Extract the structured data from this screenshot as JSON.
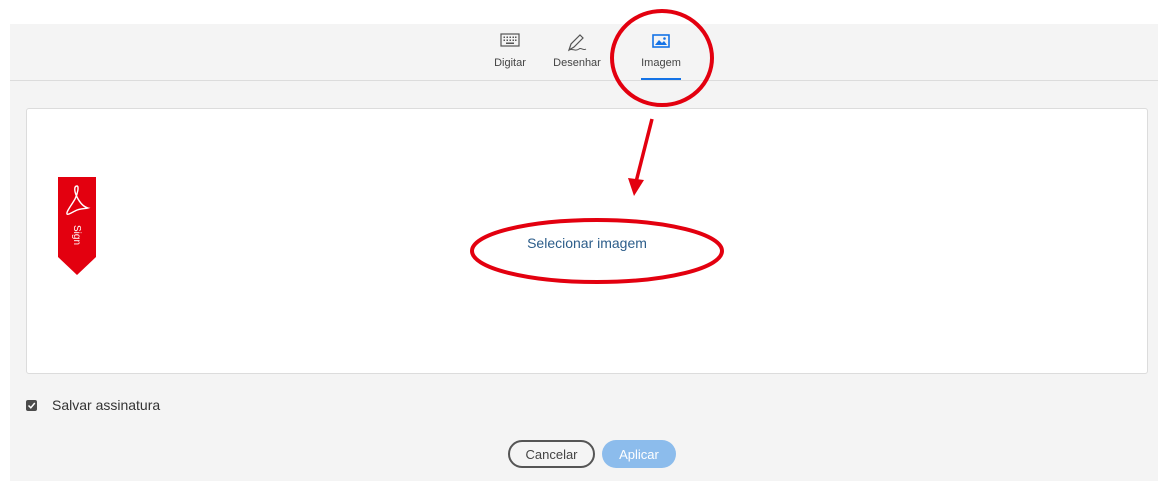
{
  "tabs": [
    {
      "label": "Digitar",
      "icon": "keyboard-icon",
      "active": false
    },
    {
      "label": "Desenhar",
      "icon": "pen-icon",
      "active": false
    },
    {
      "label": "Imagem",
      "icon": "image-icon",
      "active": true
    }
  ],
  "canvas": {
    "select_image_label": "Selecionar imagem",
    "badge_text": "Sign"
  },
  "save_signature": {
    "label": "Salvar assinatura",
    "checked": true
  },
  "buttons": {
    "cancel_label": "Cancelar",
    "apply_label": "Aplicar"
  },
  "colors": {
    "accent": "#1473e6",
    "annotation": "#e3000f",
    "badge": "#e3000f",
    "apply_button": "#8cbcec",
    "link": "#2c5d8a"
  }
}
